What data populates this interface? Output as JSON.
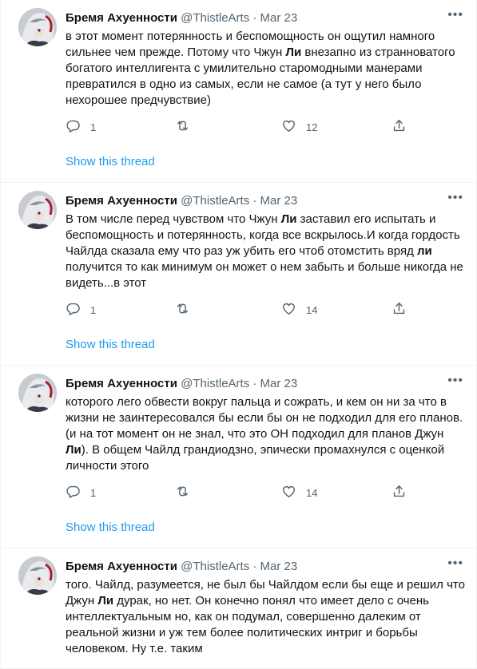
{
  "tweets": [
    {
      "author": {
        "name": "Бремя Ахуенности",
        "handle": "@ThistleArts",
        "separator": "·",
        "date": "Mar 23"
      },
      "more_label": "•••",
      "text_parts": [
        "в этот момент потерянность и  беспомощность он ощутил намного сильнее чем прежде. Потому что Чжун ",
        "Ли",
        " внезапно из странноватого богатого интеллигента с умилительно старомодными манерами превратился в одно из самых, если не самое (а тут у него было нехорошее предчувствие)"
      ],
      "reply_count": "1",
      "retweet_count": "",
      "like_count": "12",
      "show_thread": "Show this thread"
    },
    {
      "author": {
        "name": "Бремя Ахуенности",
        "handle": "@ThistleArts",
        "separator": "·",
        "date": "Mar 23"
      },
      "more_label": "•••",
      "text_parts": [
        "В том числе перед чувством что Чжун ",
        "Ли",
        " заставил его  испытать и беспомощность и потерянность, когда все вскрылось.И когда гордость Чайлда сказала ему что раз уж убить его чтоб отомстить вряд ",
        "ли",
        " получится то как минимум он может о нем забыть и больше никогда не видеть...в этот"
      ],
      "reply_count": "1",
      "retweet_count": "",
      "like_count": "14",
      "show_thread": "Show this thread"
    },
    {
      "author": {
        "name": "Бремя Ахуенности",
        "handle": "@ThistleArts",
        "separator": "·",
        "date": "Mar 23"
      },
      "more_label": "•••",
      "text_parts": [
        "которого лего обвести вокруг пальца и сожрать, и кем он ни за что в жизни не заинтересовался бы если бы он не подходил для его планов. (и на тот момент он не знал, что это ОН подходил для планов Джун ",
        "Ли",
        "). В общем Чайлд грандиодзно, эпически промахнулся с оценкой личности этого"
      ],
      "reply_count": "1",
      "retweet_count": "",
      "like_count": "14",
      "show_thread": "Show this thread"
    },
    {
      "author": {
        "name": "Бремя Ахуенности",
        "handle": "@ThistleArts",
        "separator": "·",
        "date": "Mar 23"
      },
      "more_label": "•••",
      "text_parts": [
        "того. Чайлд, разумеется, не был бы Чайлдом если бы еще и решил что Джун ",
        "Ли",
        " дурак, но нет. Он конечно понял что имеет дело с очень интеллектуальным  но, как он подумал,  совершенно далеким от реальной жизни и  уж тем более политических интриг и борьбы человеком.  Ну т.е. таким"
      ],
      "reply_count": "",
      "retweet_count": "",
      "like_count": "",
      "show_thread": ""
    }
  ]
}
